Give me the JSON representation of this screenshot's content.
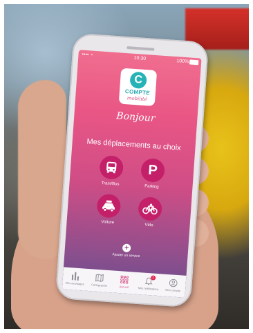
{
  "status_bar": {
    "carrier": "•••• ◔",
    "time": "10:30",
    "battery": "100%"
  },
  "logo": {
    "letter": "C",
    "line1": "COMPTE",
    "line2": "mobilité"
  },
  "greeting": "Bonjour",
  "headline": "Mes déplacements au choix",
  "services": [
    {
      "label": "Tram/Bus",
      "icon": "bus-icon"
    },
    {
      "label": "Parking",
      "icon": "parking-icon"
    },
    {
      "label": "Voiture",
      "icon": "car-icon"
    },
    {
      "label": "Vélo",
      "icon": "bicycle-icon"
    }
  ],
  "add_service": {
    "label": "Ajouter un service",
    "icon": "plus-icon"
  },
  "tabs": [
    {
      "label": "Mes avantages",
      "icon": "bars-icon"
    },
    {
      "label": "Cartographie",
      "icon": "map-icon"
    },
    {
      "label": "Accueil",
      "icon": "grid-icon",
      "active": true
    },
    {
      "label": "Mes notifications",
      "icon": "bell-icon",
      "badge": "1"
    },
    {
      "label": "Mon compte",
      "icon": "user-icon"
    }
  ],
  "colors": {
    "accent": "#d84b84",
    "teal": "#27b3b6",
    "service_circle": "#c4206a",
    "badge": "#e2264f"
  }
}
